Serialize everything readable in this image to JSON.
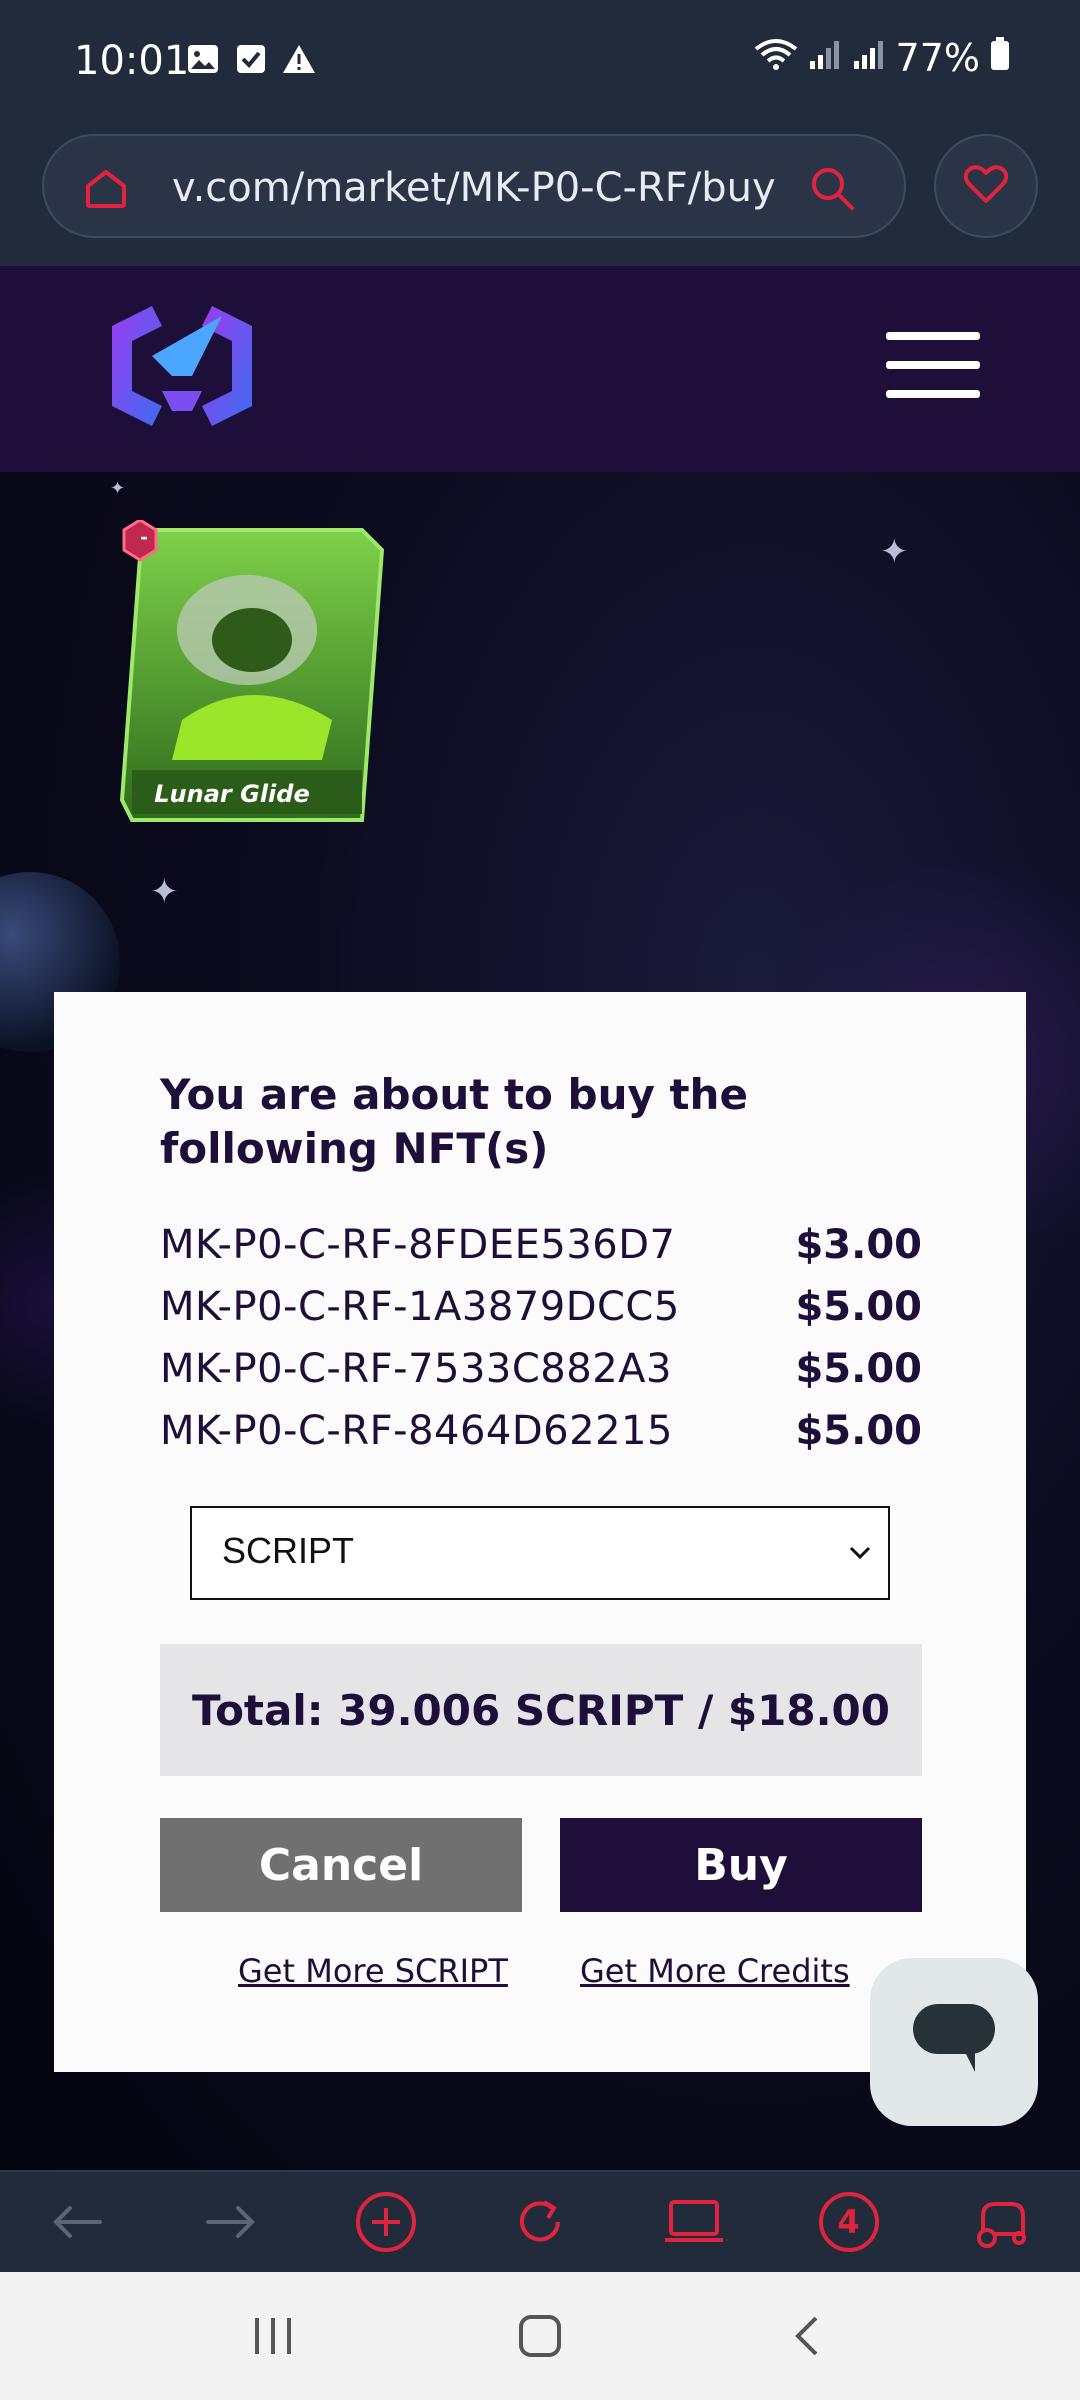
{
  "status_bar": {
    "time": "10:01",
    "battery": "77%",
    "icons_left": [
      "image-icon",
      "check-box-icon",
      "warning-icon"
    ],
    "icons_right": [
      "wifi-icon",
      "signal-icon",
      "signal-icon",
      "battery-icon"
    ]
  },
  "browser": {
    "url": "v.com/market/MK-P0-C-RF/buy",
    "accent_color": "#e0243e"
  },
  "site": {
    "header_color": "#1e0f3a"
  },
  "card": {
    "name": "Lunar Glide",
    "badge": "-"
  },
  "modal": {
    "title": "You are about to buy the following NFT(s)",
    "items": [
      {
        "id": "MK-P0-C-RF-8FDEE536D7",
        "price": "$3.00"
      },
      {
        "id": "MK-P0-C-RF-1A3879DCC5",
        "price": "$5.00"
      },
      {
        "id": "MK-P0-C-RF-7533C882A3",
        "price": "$5.00"
      },
      {
        "id": "MK-P0-C-RF-8464D62215",
        "price": "$5.00"
      }
    ],
    "currency_selected": "SCRIPT",
    "total": "Total: 39.006 SCRIPT / $18.00",
    "cancel_label": "Cancel",
    "buy_label": "Buy",
    "link_script": "Get More SCRIPT",
    "link_credits": "Get More Credits"
  },
  "toolbar": {
    "tabs_count": "4",
    "icons": [
      "back-arrow-icon",
      "forward-arrow-icon",
      "new-tab-icon",
      "reload-icon",
      "desktop-mode-icon",
      "tabs-icon",
      "extension-icon"
    ]
  },
  "navbar": {
    "icons": [
      "recent-apps-icon",
      "home-icon",
      "back-icon"
    ]
  }
}
